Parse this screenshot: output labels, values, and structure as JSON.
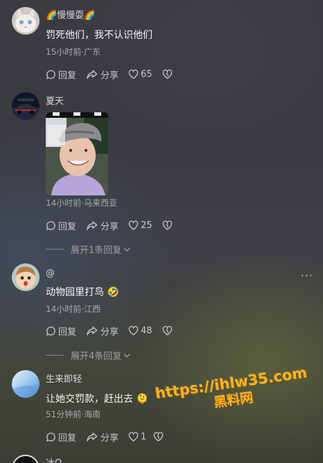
{
  "comments": [
    {
      "username": "🌈慢慢耍🌈",
      "text": "罚死他们，我不认识他们",
      "meta": "15小时前·广东",
      "reply_label": "回复",
      "share_label": "分享",
      "likes": "65"
    },
    {
      "username": "夏天",
      "meta": "14小时前·马来西亚",
      "reply_label": "回复",
      "share_label": "分享",
      "likes": "25",
      "expand_label": "展开1条回复"
    },
    {
      "username": "@",
      "text": "动物园里打鸟 🤣",
      "meta": "14小时前·江西",
      "reply_label": "回复",
      "share_label": "分享",
      "likes": "48",
      "expand_label": "展开4条回复",
      "more_label": "···"
    },
    {
      "username": "生来即轻",
      "text": "让她交罚款，赶出去 🫠",
      "meta": "51分钟前·海南",
      "reply_label": "回复",
      "share_label": "分享",
      "likes": "1"
    },
    {
      "username": "冰Q"
    }
  ],
  "watermark": {
    "url": "https://ihlw35.com",
    "name": "黑料网"
  },
  "colors": {
    "watermark": "#ffb21a",
    "meta_text": "#a9a9a9"
  }
}
